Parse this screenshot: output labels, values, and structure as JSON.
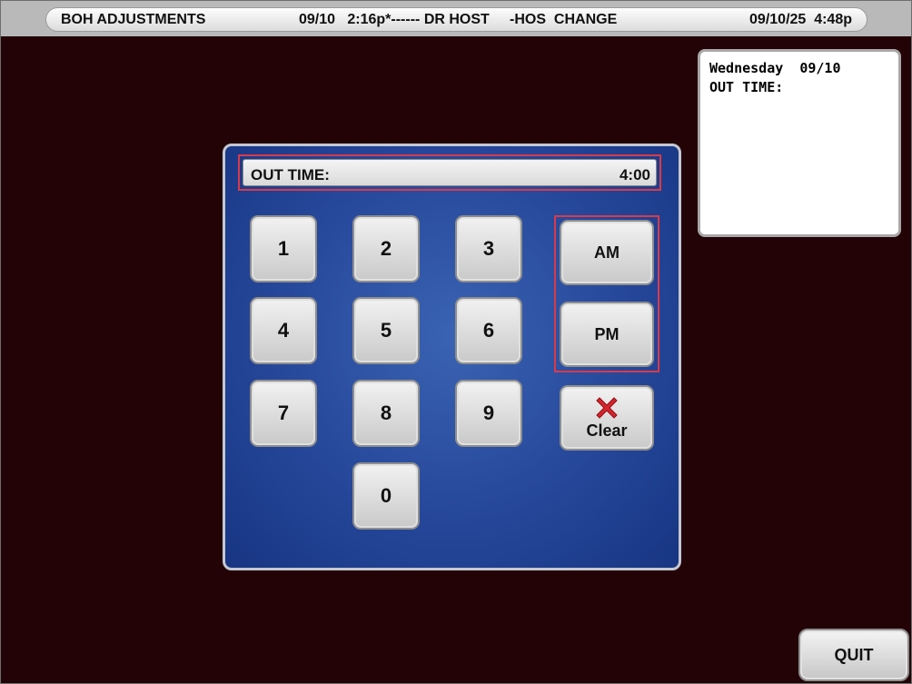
{
  "header": {
    "screen_title": "BOH ADJUSTMENTS",
    "record_info": "09/10   2:16p*------ DR HOST     -HOS  CHANGE",
    "datetime": "09/10/25  4:48p"
  },
  "info_panel": {
    "day": "Wednesday",
    "date": "09/10",
    "field_label": "OUT TIME:"
  },
  "display": {
    "label": "OUT TIME:",
    "value": "4:00"
  },
  "keypad": {
    "keys": [
      "1",
      "2",
      "3",
      "4",
      "5",
      "6",
      "7",
      "8",
      "9",
      "0"
    ],
    "am_label": "AM",
    "pm_label": "PM",
    "clear_label": "Clear"
  },
  "quit_label": "QUIT",
  "colors": {
    "background": "#230305",
    "panel_blue": "#26479a",
    "highlight_red": "#d83a4a",
    "clear_icon_red": "#d8242c"
  },
  "icons": {
    "clear": "red-x-icon"
  }
}
